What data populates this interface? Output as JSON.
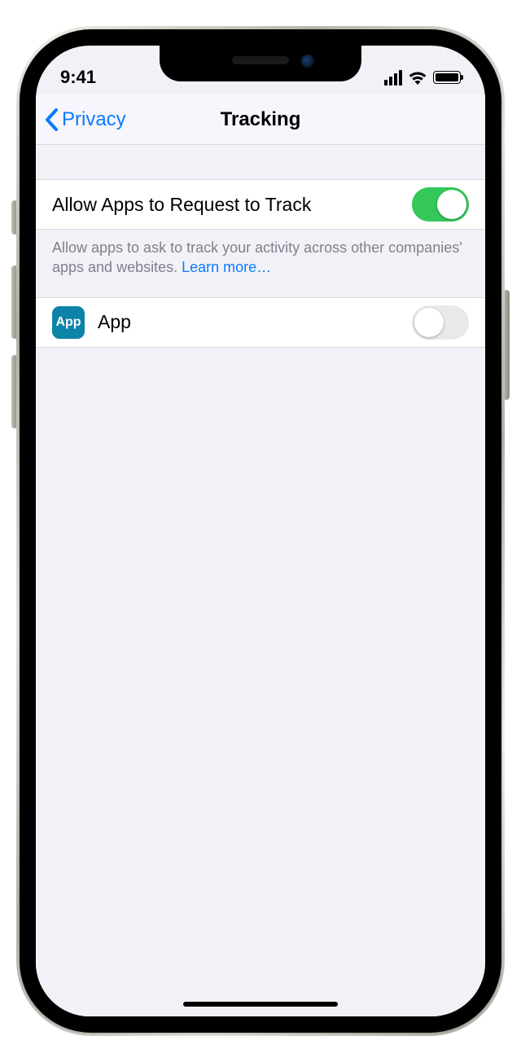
{
  "status": {
    "time": "9:41"
  },
  "nav": {
    "back_label": "Privacy",
    "title": "Tracking"
  },
  "settings": {
    "allow_row": {
      "label": "Allow Apps to Request to Track",
      "enabled": true
    },
    "footer": {
      "text": "Allow apps to ask to track your activity across other companies' apps and websites. ",
      "link_text": "Learn more…"
    },
    "apps": [
      {
        "icon_label": "App",
        "name": "App",
        "enabled": false
      }
    ]
  }
}
